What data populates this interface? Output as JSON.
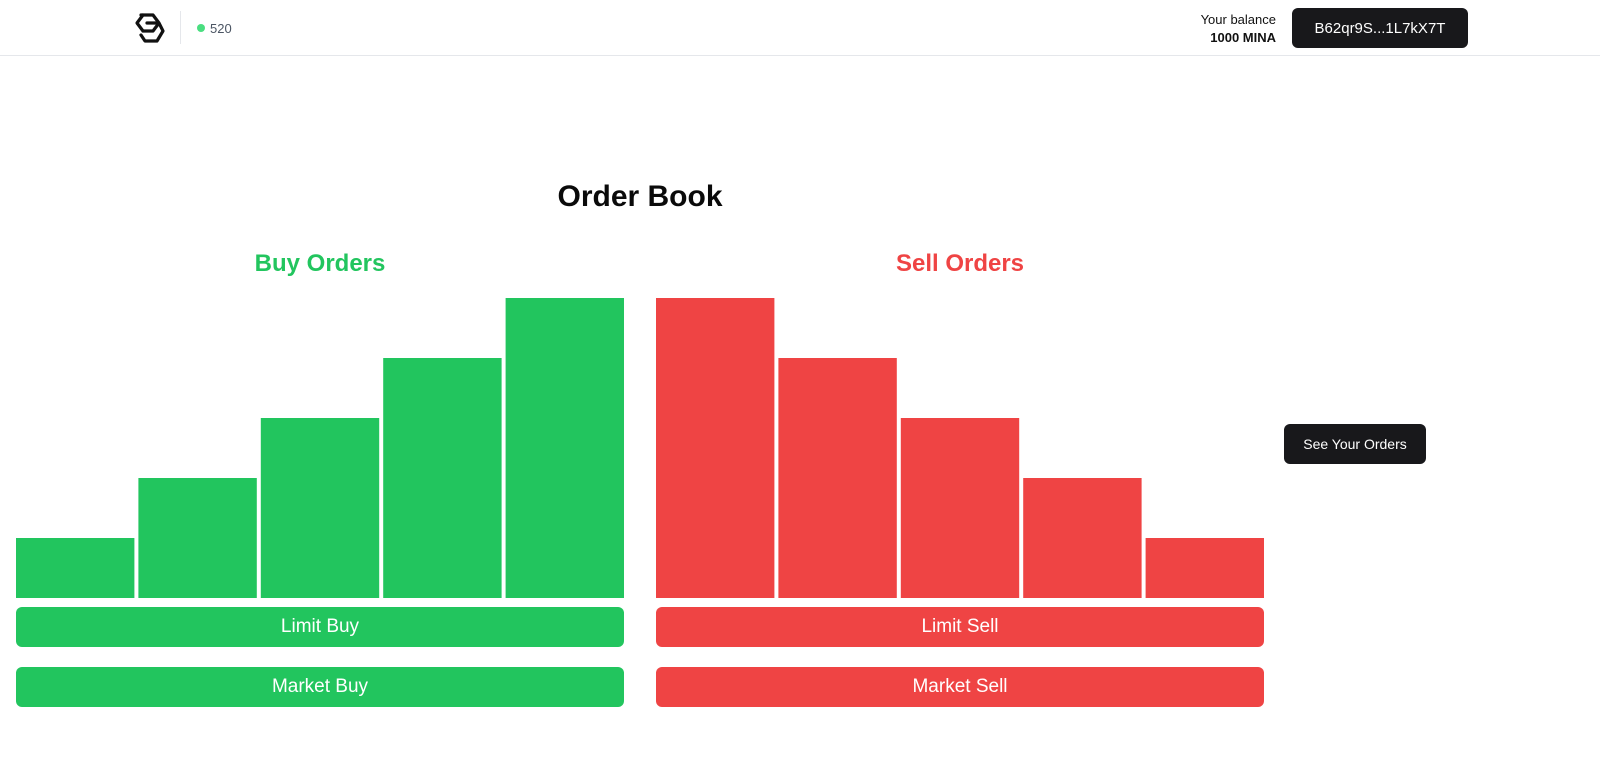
{
  "header": {
    "block_number": "520",
    "balance_label": "Your balance",
    "balance_value": "1000 MINA",
    "wallet_address": "B62qr9S...1L7kX7T",
    "status_color": "#4ade80",
    "logo_icon": "protokit-logo-icon"
  },
  "main": {
    "title": "Order Book",
    "buy": {
      "title": "Buy Orders",
      "limit_label": "Limit Buy",
      "market_label": "Market Buy",
      "color": "#22c55e"
    },
    "sell": {
      "title": "Sell Orders",
      "limit_label": "Limit Sell",
      "market_label": "Market Sell",
      "color": "#ef4444"
    },
    "see_orders_label": "See Your Orders"
  },
  "chart_data": [
    {
      "type": "bar",
      "name": "buy",
      "values": [
        1,
        2,
        3,
        4,
        5
      ],
      "ylim": [
        0,
        5
      ],
      "color": "#22c55e"
    },
    {
      "type": "bar",
      "name": "sell",
      "values": [
        5,
        4,
        3,
        2,
        1
      ],
      "ylim": [
        0,
        5
      ],
      "color": "#ef4444"
    }
  ]
}
